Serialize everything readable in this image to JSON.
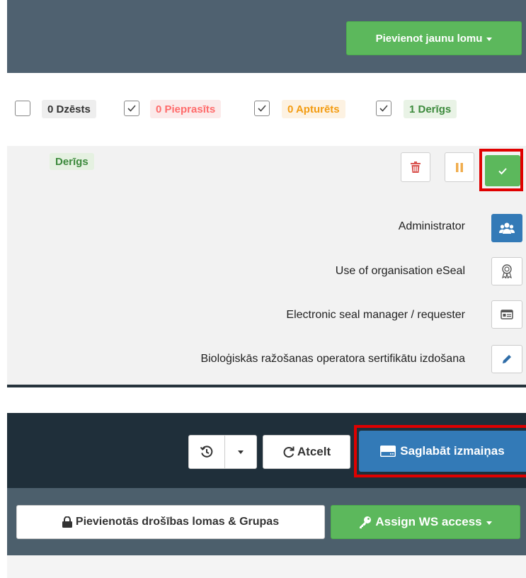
{
  "header": {
    "add_role_label": "Pievienot jaunu lomu"
  },
  "filters": [
    {
      "label": "0 Dzēsts",
      "checked": false
    },
    {
      "label": "0 Pieprasīts",
      "checked": true
    },
    {
      "label": "0 Apturēts",
      "checked": true
    },
    {
      "label": "1 Derīgs",
      "checked": true
    }
  ],
  "role": {
    "status": "Derīgs",
    "permissions": [
      {
        "label": "Administrator",
        "icon": "users-icon"
      },
      {
        "label": "Use of organisation eSeal",
        "icon": "award-icon"
      },
      {
        "label": "Electronic seal manager / requester",
        "icon": "id-card-icon"
      },
      {
        "label": "Bioloģiskās ražošanas operatora sertifikātu izdošana",
        "icon": "pencil-icon"
      }
    ]
  },
  "footer": {
    "cancel_label": "Atcelt",
    "save_label": "Saglabāt izmaiņas",
    "security_roles_label": "Pievienotās drošības lomas & Grupas",
    "assign_ws_label": "Assign WS access"
  },
  "colors": {
    "header_bg": "#4f6170",
    "success": "#5cb85c",
    "danger": "#d9534f",
    "warning": "#f0ad4e",
    "primary": "#337ab7",
    "highlight_frame": "#e00000"
  }
}
